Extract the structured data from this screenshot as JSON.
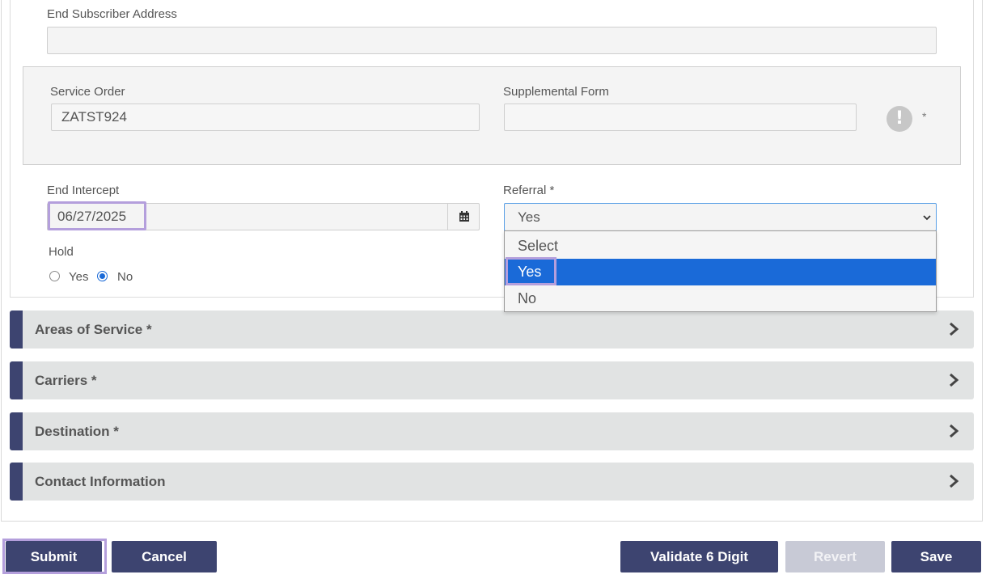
{
  "form": {
    "end_subscriber_address_label": "End Subscriber Address",
    "end_subscriber_address_value": "",
    "service_order_label": "Service Order",
    "service_order_value": "ZATST924",
    "supplemental_form_label": "Supplemental Form",
    "supplemental_form_value": "",
    "info_icon_glyph": "!",
    "required_star": "*",
    "end_intercept_label": "End Intercept",
    "end_intercept_value": "06/27/2025",
    "referral_label": "Referral *",
    "referral_value": "Yes",
    "referral_options": [
      "Select",
      "Yes",
      "No"
    ],
    "hold_label": "Hold",
    "hold_yes": "Yes",
    "hold_no": "No",
    "hold_selected": "No"
  },
  "accordions": [
    {
      "title": "Areas of Service *"
    },
    {
      "title": "Carriers *"
    },
    {
      "title": "Destination *"
    },
    {
      "title": "Contact Information"
    }
  ],
  "buttons": {
    "submit": "Submit",
    "cancel": "Cancel",
    "validate": "Validate 6 Digit",
    "revert": "Revert",
    "save": "Save"
  },
  "icons": {
    "calendar": "calendar-icon",
    "chevron": "chevron-right-icon",
    "info": "exclamation-icon",
    "select_arrow": "chevron-down-icon"
  },
  "colors": {
    "accent": "#3d4470",
    "selected_option": "#1a6ad8",
    "highlight": "#b49fdc",
    "disabled_button": "#c8cad6"
  }
}
